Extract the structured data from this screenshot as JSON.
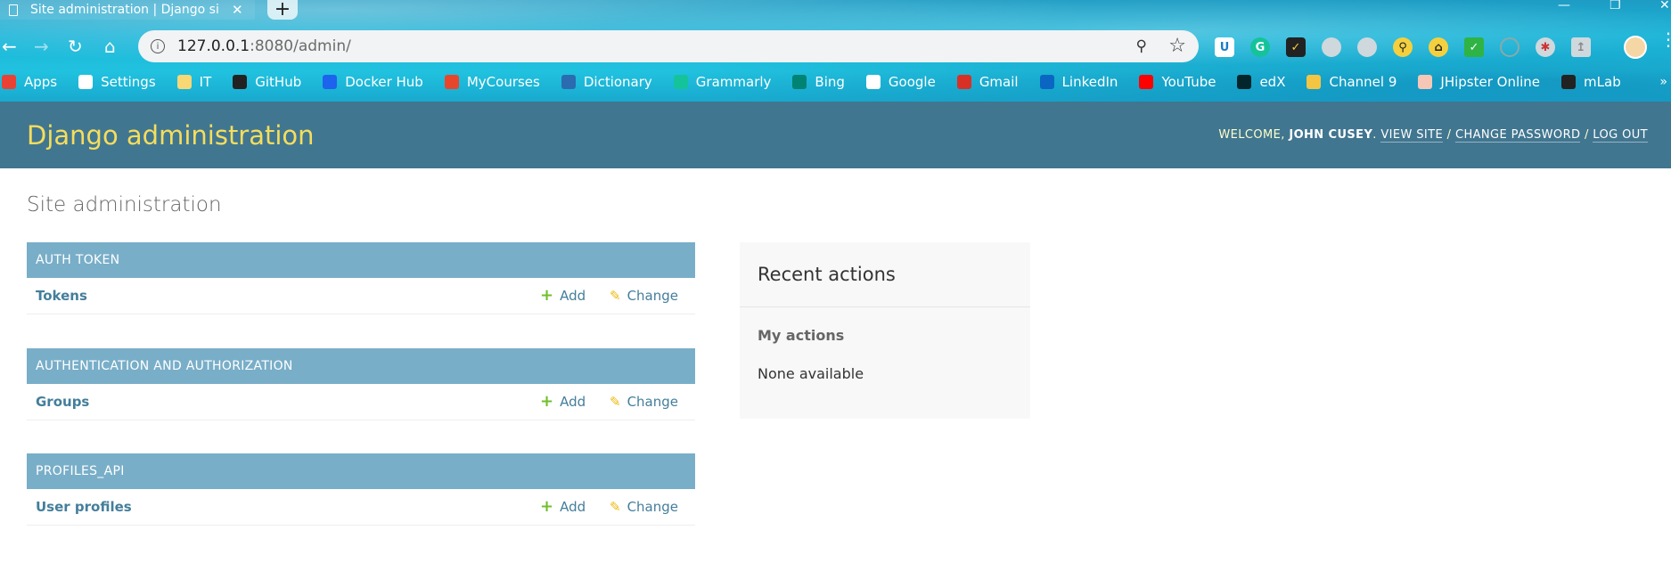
{
  "browser": {
    "tab_title": "Site administration | Django site a",
    "tab_close": "✕",
    "new_tab": "+",
    "window_controls": {
      "minimize": "—",
      "restore": "❐",
      "close": "✕"
    },
    "url_host": "127.0.0.1",
    "url_rest": ":8080/admin/",
    "info_glyph": "i",
    "bookmarks": [
      {
        "label": "Apps",
        "icon": "apps-grid-icon",
        "color": "#e94235"
      },
      {
        "label": "Settings",
        "icon": "gear-icon",
        "color": "#ffffff"
      },
      {
        "label": "IT",
        "icon": "folder-icon",
        "color": "#f8d775"
      },
      {
        "label": "GitHub",
        "icon": "github-icon",
        "color": "#222222"
      },
      {
        "label": "Docker Hub",
        "icon": "docker-icon",
        "color": "#1d63ed"
      },
      {
        "label": "MyCourses",
        "icon": "mycourses-icon",
        "color": "#e8462b"
      },
      {
        "label": "Dictionary",
        "icon": "dictionary-icon",
        "color": "#2b6cb0"
      },
      {
        "label": "Grammarly",
        "icon": "grammarly-icon",
        "color": "#15c39a"
      },
      {
        "label": "Bing",
        "icon": "bing-icon",
        "color": "#008373"
      },
      {
        "label": "Google",
        "icon": "google-icon",
        "color": "#ffffff"
      },
      {
        "label": "Gmail",
        "icon": "gmail-icon",
        "color": "#d93025"
      },
      {
        "label": "LinkedIn",
        "icon": "linkedin-icon",
        "color": "#0a66c2"
      },
      {
        "label": "YouTube",
        "icon": "youtube-icon",
        "color": "#ff0000"
      },
      {
        "label": "edX",
        "icon": "edx-icon",
        "color": "#02262b"
      },
      {
        "label": "Channel 9",
        "icon": "channel9-icon",
        "color": "#f4c542"
      },
      {
        "label": "JHipster Online",
        "icon": "jhipster-icon",
        "color": "#f6c7b6"
      },
      {
        "label": "mLab",
        "icon": "mlab-icon",
        "color": "#222222"
      }
    ],
    "bookmarks_more": "»"
  },
  "header": {
    "branding": "Django administration",
    "welcome": "WELCOME, ",
    "username": "JOHN CUSEY",
    "view_site": "VIEW SITE",
    "change_password": "CHANGE PASSWORD",
    "log_out": "LOG OUT",
    "separator": " / "
  },
  "content": {
    "title": "Site administration",
    "modules": [
      {
        "caption": "AUTH TOKEN",
        "model": "Tokens"
      },
      {
        "caption": "AUTHENTICATION AND AUTHORIZATION",
        "model": "Groups"
      },
      {
        "caption": "PROFILES_API",
        "model": "User profiles"
      }
    ],
    "add_label": "Add",
    "change_label": "Change"
  },
  "recent_actions": {
    "title": "Recent actions",
    "subtitle": "My actions",
    "empty": "None available"
  },
  "colors": {
    "header_bg": "#417690",
    "branding": "#f5dd5d",
    "caption_bg": "#79aec8",
    "link": "#447e9b",
    "add_icon": "#70bf2b",
    "change_icon": "#efb80b"
  }
}
